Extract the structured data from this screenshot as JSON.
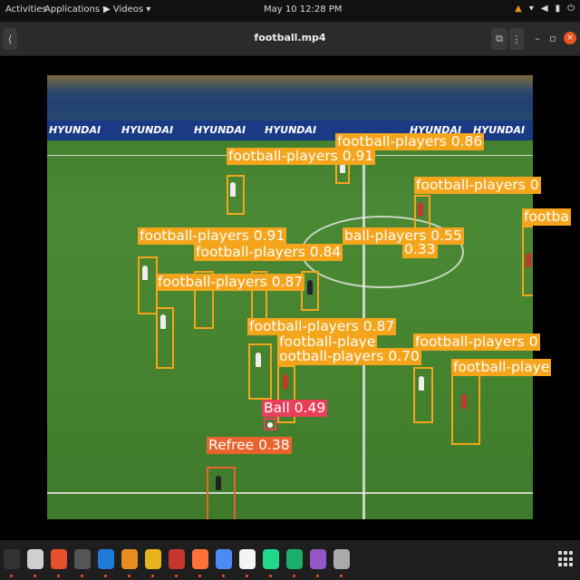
{
  "topbar": {
    "activities": "Activities",
    "applications": "Applications ▾",
    "videos": "▶ Videos ▾",
    "clock": "May 10  12:28 PM",
    "tray_icons": [
      "vlc-icon",
      "network-icon",
      "volume-icon",
      "battery-icon",
      "power-icon"
    ]
  },
  "window": {
    "title": "football.mp4",
    "back_glyph": "⟨",
    "pip_glyph": "⧉",
    "menu_glyph": "⋮",
    "min_glyph": "–",
    "max_glyph": "▫",
    "close_glyph": "×"
  },
  "video": {
    "brands": [
      "HYUNDAI",
      "HYUNDAI",
      "HYUNDAI",
      "HYUNDAI",
      "HYUNDAI",
      "HYUNDAI"
    ],
    "detections": [
      {
        "label": "football-players 0.86",
        "kind": "player"
      },
      {
        "label": "football-players 0.91",
        "kind": "player"
      },
      {
        "label": "football-players 0",
        "kind": "player"
      },
      {
        "label": "footba",
        "kind": "player"
      },
      {
        "label": "football-players 0.91",
        "kind": "player"
      },
      {
        "label": "ball-players 0.55",
        "kind": "player"
      },
      {
        "label": "football-players 0.84",
        "kind": "player"
      },
      {
        "label": "0.33",
        "kind": "player"
      },
      {
        "label": "football-players 0.87",
        "kind": "player"
      },
      {
        "label": "football-players 0.87",
        "kind": "player"
      },
      {
        "label": "football-playe",
        "kind": "player"
      },
      {
        "label": "football-players 0",
        "kind": "player"
      },
      {
        "label": "ootball-players 0.70",
        "kind": "player"
      },
      {
        "label": "football-playe",
        "kind": "player"
      },
      {
        "label": "Ball 0.49",
        "kind": "ball"
      },
      {
        "label": "Refree 0.38",
        "kind": "referee"
      }
    ]
  },
  "dock": {
    "apps": [
      "terminal-icon",
      "files-icon",
      "brave-icon",
      "obs-icon",
      "vscode-icon",
      "ubuntu-software-icon",
      "rhythmbox-icon",
      "color-app-icon",
      "firefox-icon",
      "chrome-icon",
      "text-editor-icon",
      "pycharm-icon",
      "jetbrains-icon",
      "videos-icon",
      "trash-icon"
    ],
    "colors": [
      "#333333",
      "#cfcfcf",
      "#e5512a",
      "#555555",
      "#1e7ad6",
      "#e88c1f",
      "#e8b31d",
      "#c7362c",
      "#ff7139",
      "#4c8bf5",
      "#f4f4f4",
      "#21d789",
      "#1ab06a",
      "#9455c6",
      "#aaaaaa"
    ]
  }
}
